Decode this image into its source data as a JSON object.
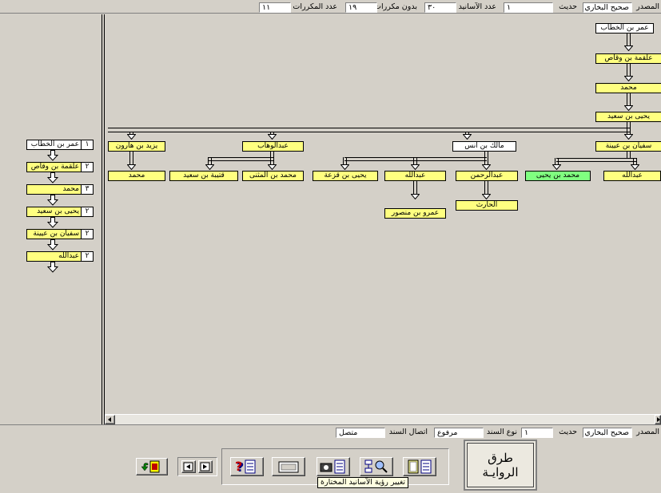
{
  "top_bar": {
    "source_label": "المصدر",
    "source_value": "صحيح البخاري",
    "hadith_label": "حديث",
    "hadith_value": "١",
    "chains_count_label": "عدد الآسانيد",
    "chains_count_value": "٣٠",
    "no_repeat_label": "بدون مكررات",
    "no_repeat_value": "١٩",
    "repeat_count_label": "عدد المكررات",
    "repeat_count_value": "١١"
  },
  "tree": {
    "col_main": [
      "عمر بن الخطاب",
      "علقمة بن وقاص",
      "محمد",
      "يحيى بن سعيد"
    ],
    "level5": [
      "سفيان بن عيينة",
      "مالك بن أنس",
      "عبدالوهاب",
      "يزيد بن هارون"
    ],
    "level6": [
      "عبدالله",
      "محمد بن يحيى",
      "عبدالرحمن",
      "عبدالله",
      "يحيى بن قزعة",
      "محمد بن المثنى",
      "قتيبة بن سعيد",
      "محمد"
    ],
    "level7": [
      "الحارث",
      "عمرو بن منصور"
    ]
  },
  "left_chain": [
    {
      "num": "١",
      "name": "عمر بن الخطاب"
    },
    {
      "num": "٢",
      "name": "علقمة بن وقاص"
    },
    {
      "num": "٣",
      "name": "محمد"
    },
    {
      "num": "٢",
      "name": "يحيى بن سعيد"
    },
    {
      "num": "٢",
      "name": "سفيان بن عيينة"
    },
    {
      "num": "٢",
      "name": "عبدالله"
    }
  ],
  "bottom_bar": {
    "source_label": "المصدر",
    "source_value": "صحيح البخاري",
    "hadith_label": "حديث",
    "hadith_value": "١",
    "sanad_type_label": "نوع السند",
    "sanad_type_value": "مرفوع",
    "sanad_conn_label": "اتصال السند",
    "sanad_conn_value": "متصل"
  },
  "logo": {
    "line1": "طرق",
    "line2": "الروايـة"
  },
  "tooltip": "تغيير رؤية الآسانيد المختارة",
  "icons": [
    "exit-door-icon",
    "nav-left-icon",
    "nav-right-icon",
    "help-tree-icon",
    "card-icon",
    "camera-tree-icon",
    "search-tree-icon",
    "view-tree-icon"
  ],
  "colors": {
    "highlight_yellow": "#ffff80",
    "selected_green": "#80ff80",
    "window_bg": "#d4d0c8"
  }
}
